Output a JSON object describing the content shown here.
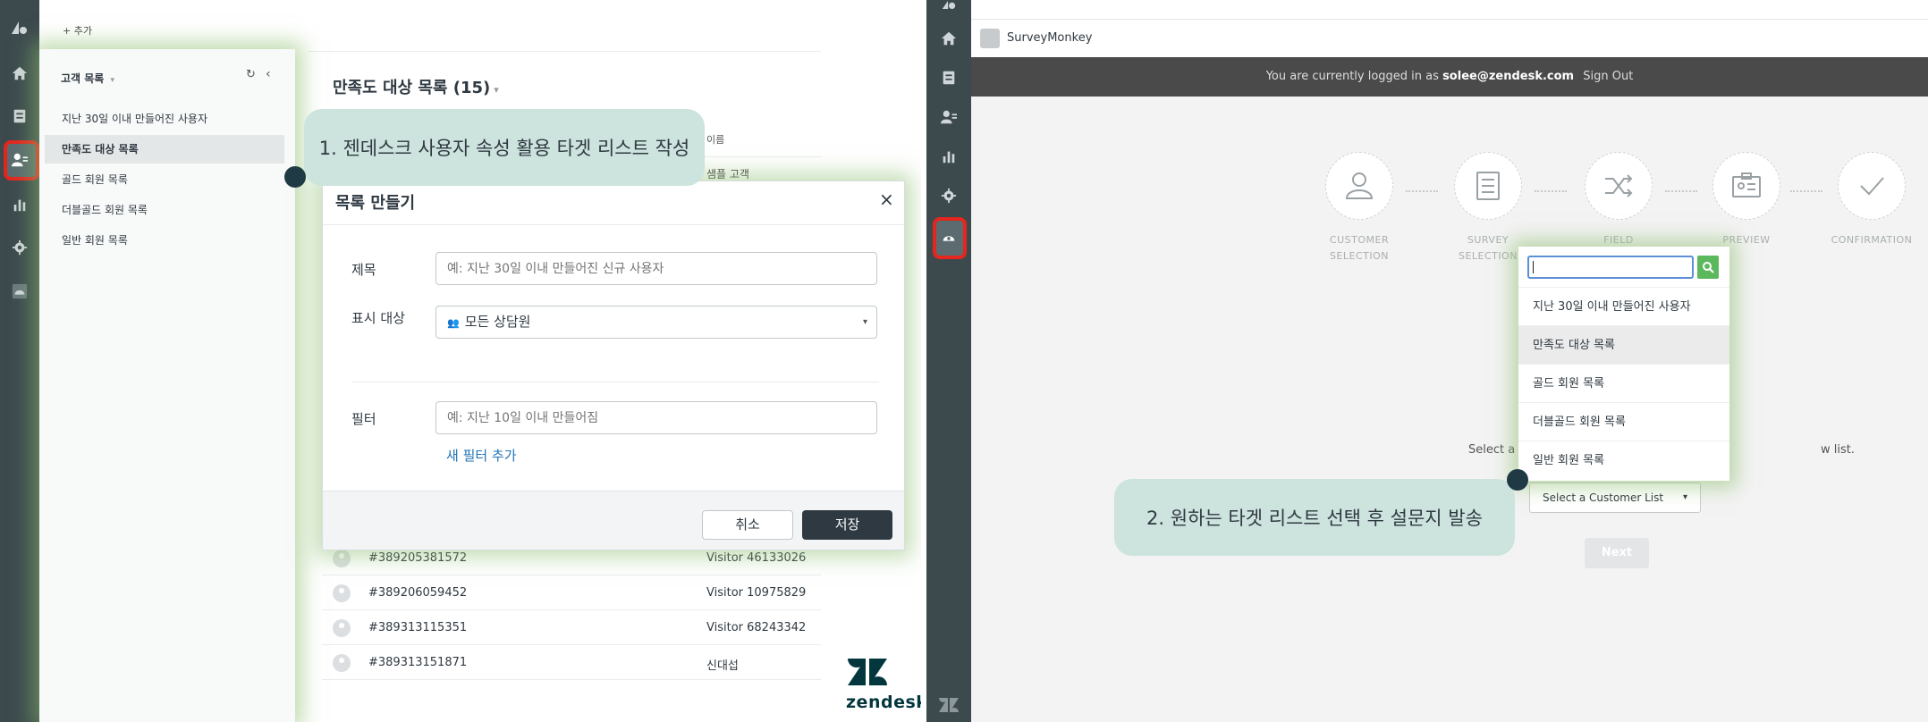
{
  "left": {
    "topbar": {
      "add_label": "+ 추가"
    },
    "views": {
      "header": "고객 목록",
      "header_caret": "▾",
      "refresh_icon": "↻",
      "collapse_icon": "‹",
      "items": [
        {
          "label": "지난 30일 이내 만들어진 사용자",
          "selected": false
        },
        {
          "label": "만족도 대상 목록",
          "selected": true
        },
        {
          "label": "골드 회원 목록",
          "selected": false
        },
        {
          "label": "더블골드 회원 목록",
          "selected": false
        },
        {
          "label": "일반 회원 목록",
          "selected": false
        }
      ]
    },
    "main": {
      "title": "만족도 대상 목록 (15)",
      "title_caret": "▾",
      "column_name": "이름",
      "first_cell": "샘플 고객",
      "rows": [
        {
          "id": "#389205381572",
          "name": "Visitor 46133026"
        },
        {
          "id": "#389206059452",
          "name": "Visitor 10975829"
        },
        {
          "id": "#389313115351",
          "name": "Visitor 68243342"
        },
        {
          "id": "#389313151871",
          "name": "신대섭"
        }
      ]
    },
    "callout": "1. 젠데스크 사용자 속성 활용 타겟 리스트 작성",
    "modal": {
      "title": "목록 만들기",
      "close": "×",
      "title_label": "제목",
      "title_placeholder": "예: 지난 30일 이내 만들어진 신규 사용자",
      "audience_label": "표시 대상",
      "audience_value": "모든 상담원",
      "audience_caret": "▾",
      "filter_label": "필터",
      "filter_placeholder": "예: 지난 10일 이내 만들어짐",
      "add_filter": "새 필터 추가",
      "cancel": "취소",
      "save": "저장"
    },
    "brand": "zendesk"
  },
  "right": {
    "app_name": "SurveyMonkey",
    "banner": {
      "prefix": "You are currently logged in as",
      "user": "solee@zendesk.com",
      "signout": "Sign Out"
    },
    "steps": [
      {
        "line1": "CUSTOMER",
        "line2": "SELECTION",
        "icon": "user-icon"
      },
      {
        "line1": "SURVEY",
        "line2": "SELECTION",
        "icon": "document-icon"
      },
      {
        "line1": "FIELD",
        "line2": "",
        "icon": "shuffle-icon"
      },
      {
        "line1": "PREVIEW",
        "line2": "",
        "icon": "id-card-icon"
      },
      {
        "line1": "CONFIRMATION",
        "line2": "",
        "icon": "checkmark-icon"
      }
    ],
    "select_text_start": "Select a",
    "select_text_end": "w list.",
    "select_button": "Select a Customer List",
    "select_caret": "▾",
    "next": "Next",
    "dropdown": {
      "items": [
        {
          "label": "지난 30일 이내 만들어진 사용자",
          "selected": false
        },
        {
          "label": "만족도 대상 목록",
          "selected": true
        },
        {
          "label": "골드 회원 목록",
          "selected": false
        },
        {
          "label": "더블골드 회원 목록",
          "selected": false
        },
        {
          "label": "일반 회원 목록",
          "selected": false
        }
      ]
    },
    "callout": "2. 원하는 타겟 리스트 선택 후 설문지 발송"
  },
  "colors": {
    "rail": "#3c4a4e",
    "highlight": "#e4261f",
    "callout": "#cde3de",
    "save_button": "#2f3941",
    "link": "#1f73b7",
    "search_button": "#5cb85c"
  }
}
